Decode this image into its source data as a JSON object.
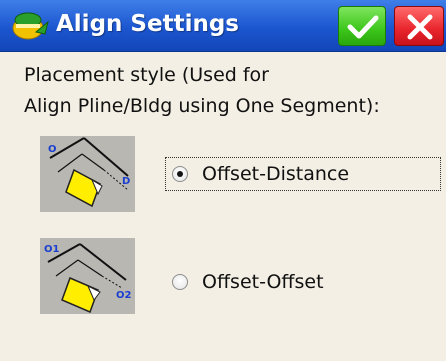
{
  "window": {
    "title": "Align Settings",
    "icons": {
      "app": "surveyor-app-icon",
      "ok": "checkmark-icon",
      "cancel": "close-icon"
    }
  },
  "description": {
    "line1": "Placement style (Used for",
    "line2": "Align Pline/Bldg using One Segment):"
  },
  "placement_options": [
    {
      "label": "Offset-Distance",
      "selected": true,
      "diagram_labels": [
        "O",
        "D"
      ]
    },
    {
      "label": "Offset-Offset",
      "selected": false,
      "diagram_labels": [
        "O1",
        "O2"
      ]
    }
  ],
  "colors": {
    "titlebar": "#1c56d0",
    "ok": "#3cc61a",
    "cancel": "#e8242c",
    "background": "#f3efe4",
    "building_fill": "#ffee00"
  }
}
